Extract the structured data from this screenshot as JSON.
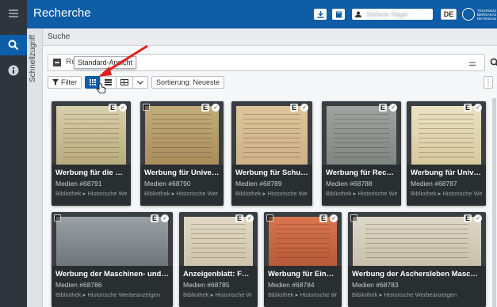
{
  "app": {
    "title": "Recherche",
    "user_name": "Stefanie Nagel",
    "language": "DE",
    "logo_text": [
      "TECHNISCHE UNIVERSITÄT",
      "BERGAKADEMIE FREIBERG",
      "Die Ressourcenuniversität. Seit 1765."
    ]
  },
  "sidebar": {
    "quick_access_label": "Schnellzugriff",
    "icons": [
      "menu-icon",
      "search-icon",
      "info-icon"
    ]
  },
  "search": {
    "section_label": "Suche",
    "field_value": "Re",
    "view_pill": "Standard-Ansicht"
  },
  "toolbar": {
    "filter_label": "Filter",
    "sort_label": "Sortierung: Neueste",
    "view_modes": [
      "grid",
      "list",
      "table"
    ]
  },
  "cards": [
    {
      "title": "Werbung für die Feu...",
      "media": "Medien  #68791",
      "path": "Bibliothek ▸ Historische We",
      "badge": "E"
    },
    {
      "title": "Werbung für Univers...",
      "media": "Medien  #68790",
      "path": "Bibliothek ▸ Historische Wer",
      "badge": "E"
    },
    {
      "title": "Werbung für Schutzb...",
      "media": "Medien  #68789",
      "path": "Bibliothek ▸ Historische We",
      "badge": "E"
    },
    {
      "title": "Werbung für Receiv...",
      "media": "Medien  #68788",
      "path": "Bibliothek ▸ Historische We",
      "badge": "E"
    },
    {
      "title": "Werbung für Univers...",
      "media": "Medien  #68787",
      "path": "Bibliothek ▸ Historische We",
      "badge": "E"
    },
    {
      "title": "Werbung der Maschinen- und Ar...",
      "media": "Medien  #68786",
      "path": "Bibliothek ▸ Historische Werbeanzeigen",
      "badge": "E"
    },
    {
      "title": "Anzeigenblatt: Füh...",
      "media": "Medien  #68785",
      "path": "Bibliothek ▸ Historische W",
      "badge": "E"
    },
    {
      "title": "Werbung für Einba...",
      "media": "Medien  #68784",
      "path": "Bibliothek ▸ Historische W",
      "badge": "E"
    },
    {
      "title": "Werbung der Aschersleben Maschinen...",
      "media": "Medien  #68783",
      "path": "Bibliothek ▸ Historische Werbeanzeigen",
      "badge": "E"
    }
  ]
}
